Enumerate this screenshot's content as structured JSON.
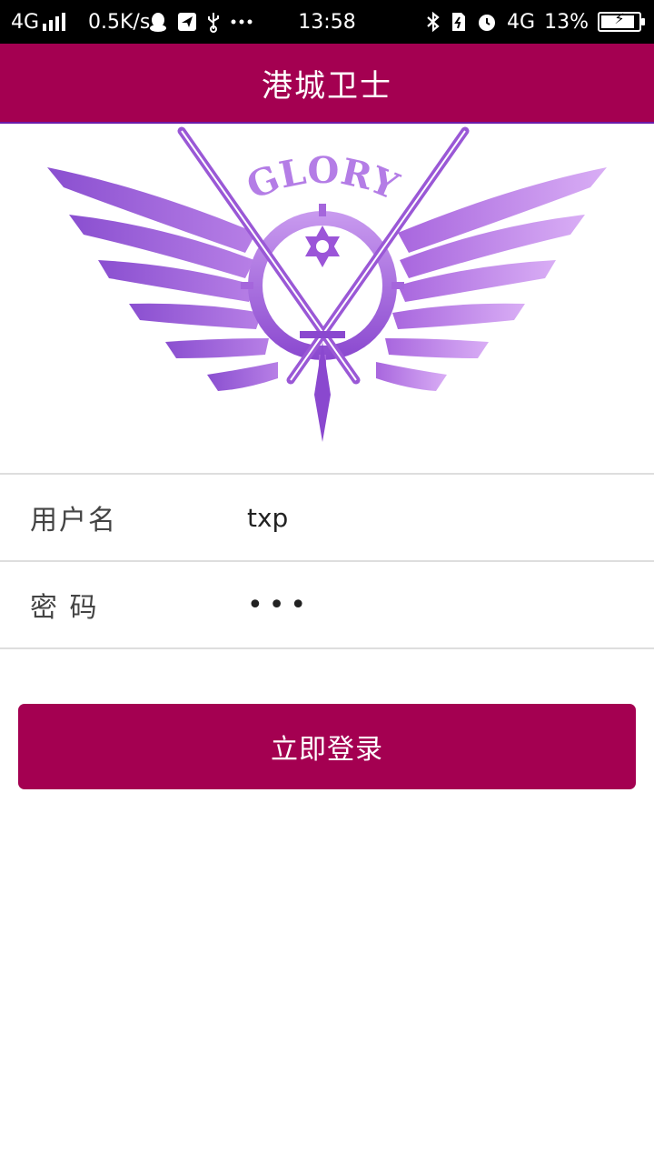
{
  "status_bar": {
    "network": "4G",
    "speed": "0.5K/s",
    "time": "13:58",
    "network_right": "4G",
    "battery": "13%",
    "notification_icons": [
      "qq-icon",
      "send-icon",
      "usb-icon",
      "more-icon"
    ],
    "system_icons": [
      "bluetooth-icon",
      "sim-icon",
      "alarm-icon",
      "battery-icon"
    ]
  },
  "app_bar": {
    "title": "港城卫士",
    "color": "#a40051"
  },
  "logo": {
    "text": "GLORY",
    "colors": [
      "#7b3fc4",
      "#b06be0",
      "#d8a8f5"
    ]
  },
  "form": {
    "username_label": "用户名",
    "username_value": "txp",
    "password_label": "密 码",
    "password_value": "•••"
  },
  "login_button": {
    "label": "立即登录",
    "color": "#a40051"
  }
}
